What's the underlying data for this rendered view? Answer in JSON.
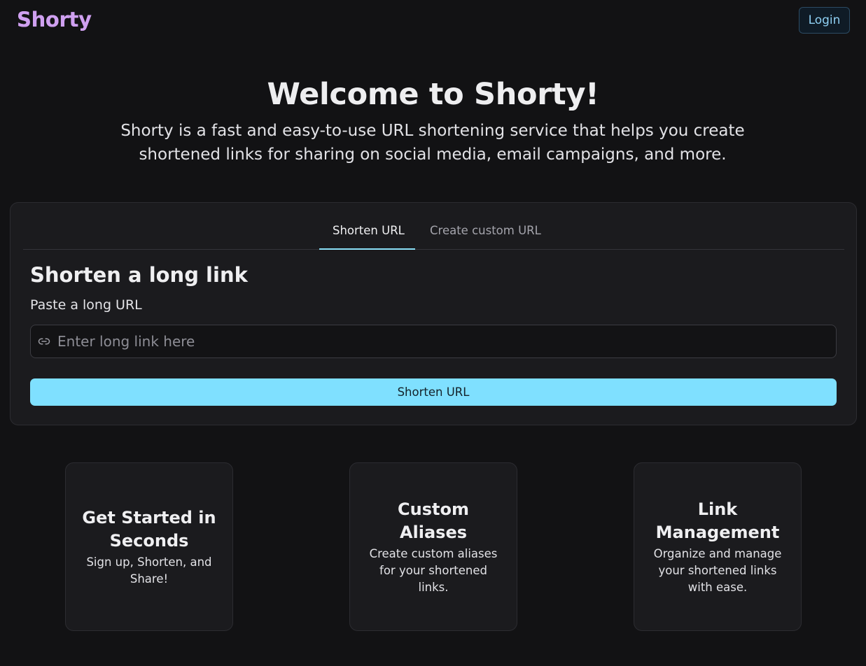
{
  "header": {
    "logo": "Shorty",
    "login_label": "Login"
  },
  "hero": {
    "title": "Welcome to Shorty!",
    "subtitle": "Shorty is a fast and easy-to-use URL shortening service that helps you create shortened links for sharing on social media, email campaigns, and more."
  },
  "shortener": {
    "tabs": [
      {
        "label": "Shorten URL",
        "active": true
      },
      {
        "label": "Create custom URL",
        "active": false
      }
    ],
    "title": "Shorten a long link",
    "field_label": "Paste a long URL",
    "input_value": "",
    "input_placeholder": "Enter long link here",
    "input_icon": "link-icon",
    "submit_label": "Shorten URL"
  },
  "features": [
    {
      "title": "Get Started in Seconds",
      "description": "Sign up, Shorten, and Share!"
    },
    {
      "title": "Custom Aliases",
      "description": "Create custom aliases for your shortened links."
    },
    {
      "title": "Link Management",
      "description": "Organize and manage your shortened links with ease."
    }
  ],
  "colors": {
    "background": "#121214",
    "card": "#1b1b1e",
    "accent": "#7fe0ff",
    "logo": "#cfa0f0"
  }
}
